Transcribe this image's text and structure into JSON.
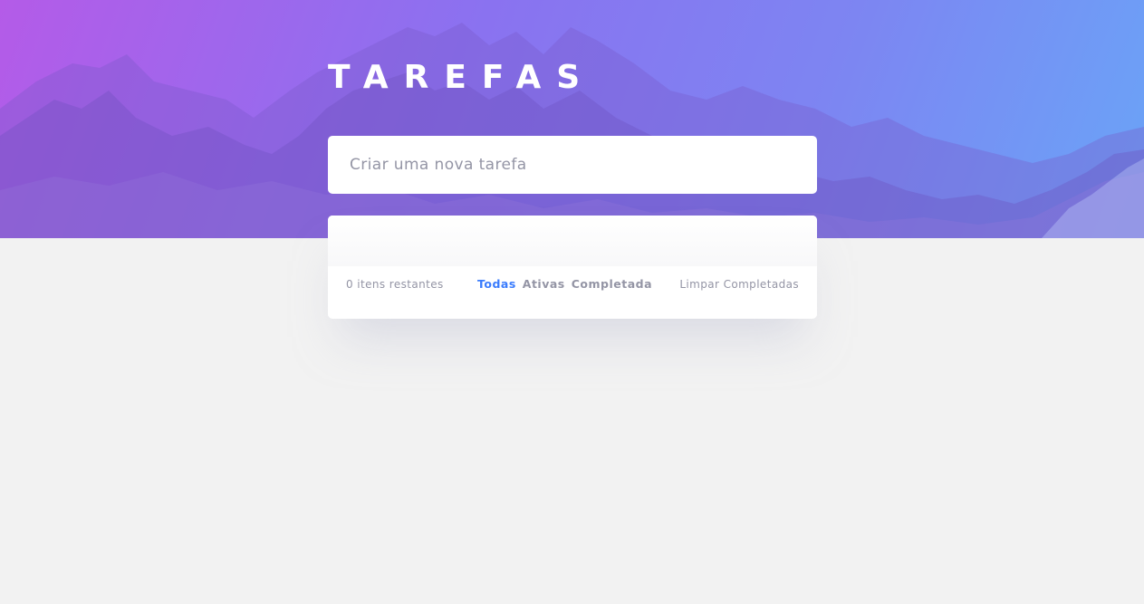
{
  "header": {
    "title": "TAREFAS"
  },
  "new_task": {
    "placeholder": "Criar uma nova tarefa",
    "value": ""
  },
  "footer": {
    "items_left": "0 itens restantes",
    "filters": [
      {
        "label": "Todas",
        "active": true
      },
      {
        "label": "Ativas",
        "active": false
      },
      {
        "label": "Completada",
        "active": false
      }
    ],
    "clear_label": "Limpar Completadas"
  },
  "colors": {
    "accent": "#3a7cfd",
    "background": "#f2f2f2",
    "gradient_start": "#b45be8",
    "gradient_end": "#6aa4f7"
  }
}
